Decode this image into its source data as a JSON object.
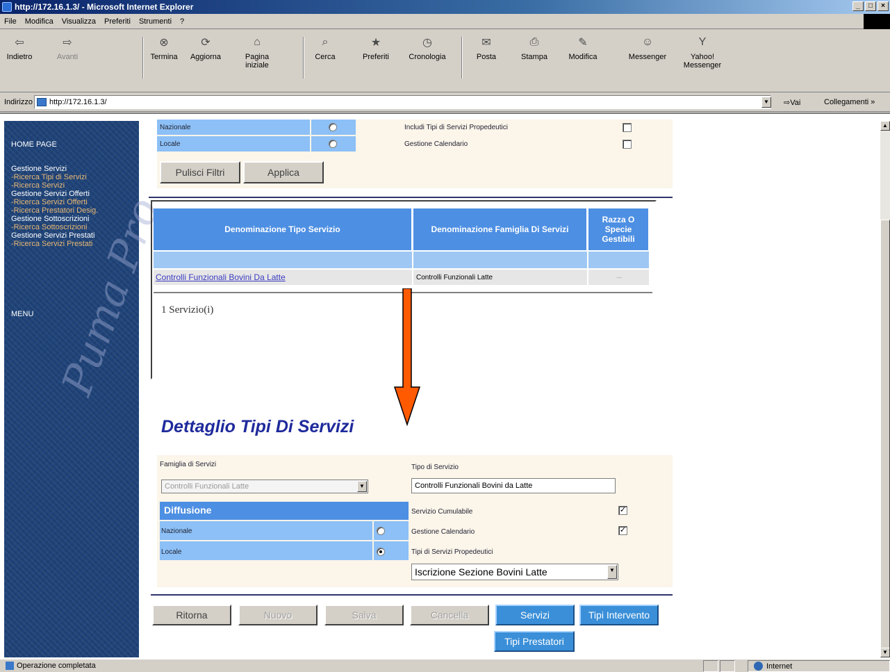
{
  "window": {
    "title": "http://172.16.1.3/ - Microsoft Internet Explorer"
  },
  "menu": [
    "File",
    "Modifica",
    "Visualizza",
    "Preferiti",
    "Strumenti",
    "?"
  ],
  "toolbar": {
    "back": "Indietro",
    "forward": "Avanti",
    "stop": "Termina",
    "refresh": "Aggiorna",
    "home_1": "Pagina",
    "home_2": "iniziale",
    "search": "Cerca",
    "favorites": "Preferiti",
    "history": "Cronologia",
    "mail": "Posta",
    "print": "Stampa",
    "edit": "Modifica",
    "messenger": "Messenger",
    "yahoo_1": "Yahoo!",
    "yahoo_2": "Messenger"
  },
  "address": {
    "label": "Indirizzo",
    "url": "http://172.16.1.3/",
    "go": "Vai",
    "links": "Collegamenti »"
  },
  "sidebar": {
    "home": "HOME PAGE",
    "items": [
      {
        "label": "Gestione Servizi",
        "type": "section"
      },
      {
        "label": "-Ricerca Tipi di Servizi",
        "type": "link"
      },
      {
        "label": "-Ricerca Servizi",
        "type": "link"
      },
      {
        "label": "Gestione Servizi Offerti",
        "type": "section"
      },
      {
        "label": "-Ricerca Servizi Offerti",
        "type": "link"
      },
      {
        "label": "-Ricerca Prestatori Desig.",
        "type": "link"
      },
      {
        "label": "Gestione Sottoscrizioni",
        "type": "section"
      },
      {
        "label": "-Ricerca Sottoscrizioni",
        "type": "link"
      },
      {
        "label": "Gestione Servizi Prestati",
        "type": "section"
      },
      {
        "label": "-Ricerca Servizi Prestati",
        "type": "link"
      }
    ],
    "menu": "MENU"
  },
  "filters": {
    "nazionale": "Nazionale",
    "locale": "Locale",
    "includi": "Includi Tipi di Servizi Propedeutici",
    "calendario": "Gestione Calendario",
    "pulisci": "Pulisci Filtri",
    "applica": "Applica"
  },
  "results": {
    "headers": [
      "Denominazione Tipo Servizio",
      "Denominazione Famiglia Di Servizi",
      "Razza O Specie Gestibili"
    ],
    "rows": [
      {
        "tipo": "Controlli Funzionali Bovini Da Latte",
        "famiglia": "Controlli Funzionali Latte",
        "razza": "..."
      }
    ],
    "count": "1 Servizio(i)"
  },
  "detail": {
    "title": "Dettaglio Tipi Di Servizi",
    "famiglia_label": "Famiglia di Servizi",
    "famiglia_value": "Controlli Funzionali  Latte",
    "tipo_label": "Tipo di Servizio",
    "tipo_value": "Controlli Funzionali Bovini da Latte",
    "diffusione": "Diffusione",
    "nazionale": "Nazionale",
    "locale": "Locale",
    "cumulabile": "Servizio Cumulabile",
    "calendario": "Gestione Calendario",
    "propedeutici": "Tipi di Servizi Propedeutici",
    "propedeutici_value": "Iscrizione Sezione Bovini Latte"
  },
  "buttons": {
    "ritorna": "Ritorna",
    "nuovo": "Nuovo",
    "salva": "Salva",
    "cancella": "Cancella",
    "servizi": "Servizi",
    "tipi_intervento": "Tipi Intervento",
    "tipi_prestatori": "Tipi Prestatori"
  },
  "status": {
    "text": "Operazione completata",
    "zone": "Internet"
  },
  "colors": {
    "arrow": "#ff5a00",
    "header_blue": "#4d8fe3",
    "title_blue": "#1f2a9c"
  }
}
